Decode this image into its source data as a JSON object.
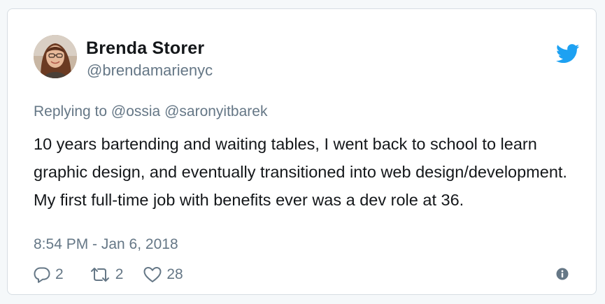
{
  "tweet": {
    "author_name": "Brenda Storer",
    "author_handle": "@brendamarienyc",
    "replying_to": "Replying to @ossia @saronyitbarek",
    "text": "10 years bartending and waiting tables, I went back to school to learn graphic design, and eventually transitioned into web design/development. My first full-time job with benefits ever was a dev role at 36.",
    "timestamp": "8:54 PM - Jan 6, 2018",
    "reply_count": "2",
    "retweet_count": "2",
    "like_count": "28"
  },
  "icons": {
    "brand": "twitter-bird-icon",
    "reply": "reply-icon",
    "retweet": "retweet-icon",
    "like": "heart-icon",
    "info": "info-icon"
  },
  "colors": {
    "brand_blue": "#1da1f2",
    "muted_text": "#657786",
    "primary_text": "#14171a",
    "card_border": "#d6dde3"
  }
}
